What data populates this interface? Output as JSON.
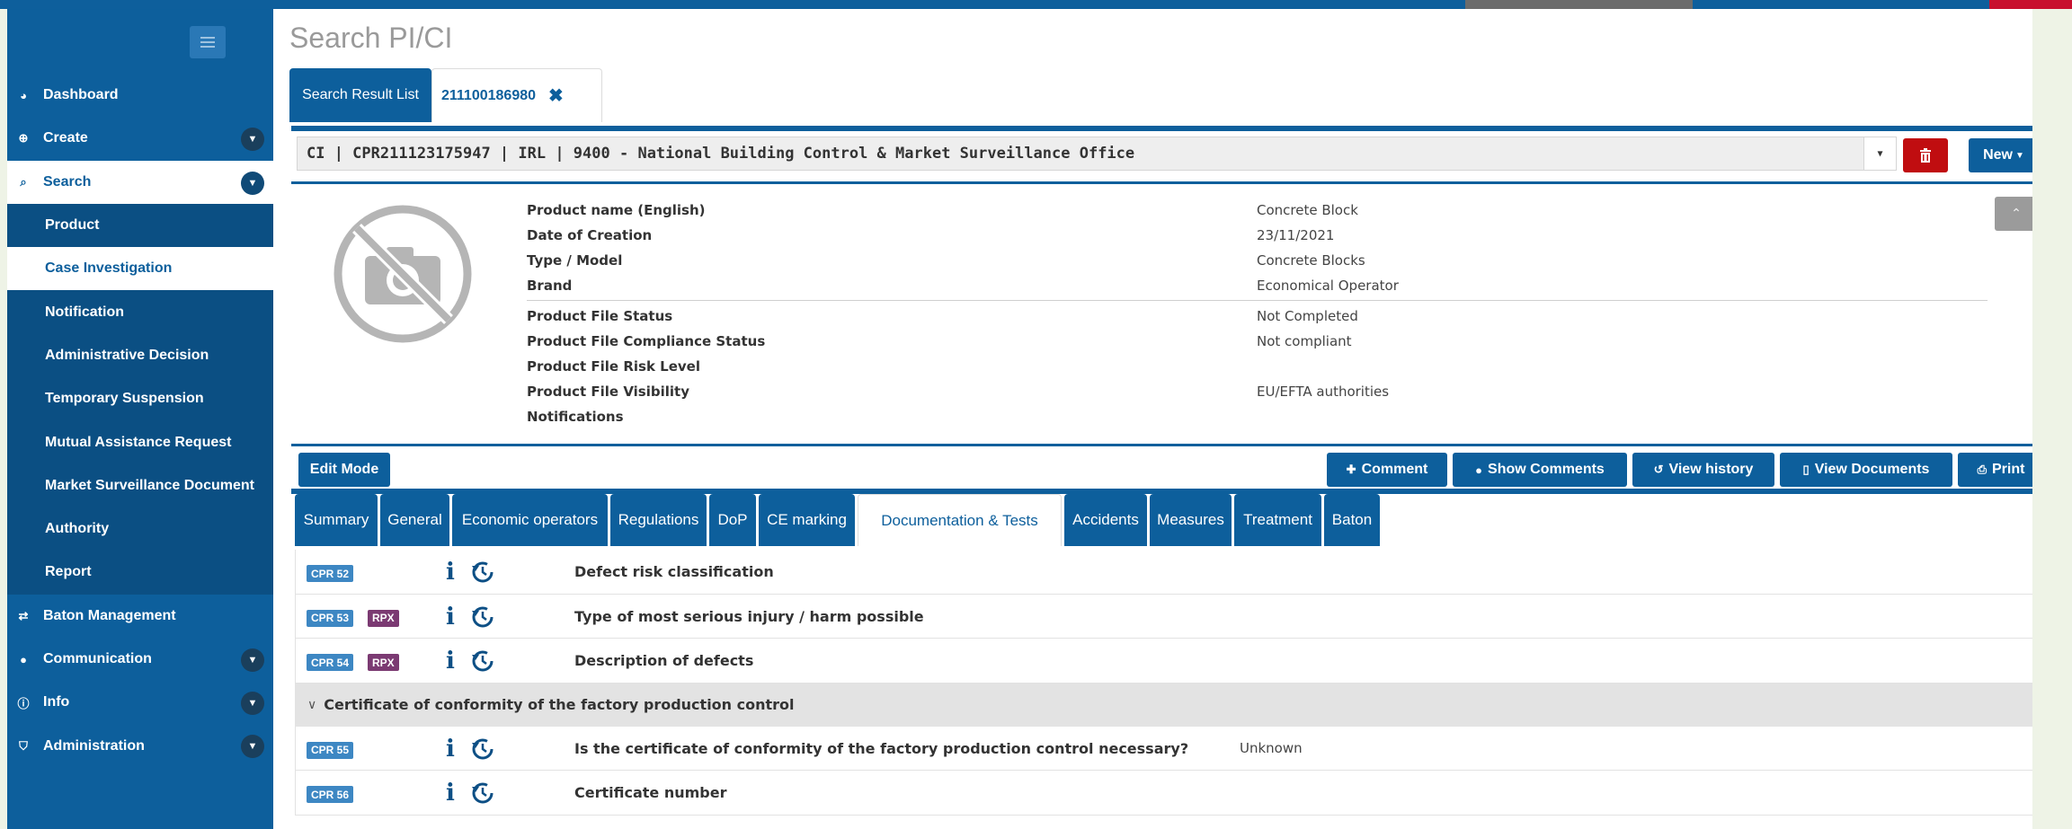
{
  "top_strip": {
    "segment_colors": [
      "#0e5f9c",
      "#6c6c6c",
      "#0e5f9c",
      "#0e5f9c",
      "#c8102e"
    ]
  },
  "sidebar": {
    "items": [
      {
        "label": "Dashboard",
        "icon": "dashboard-icon",
        "has_caret": false
      },
      {
        "label": "Create",
        "icon": "plus-circle-icon",
        "has_caret": true
      },
      {
        "label": "Search",
        "icon": "search-icon",
        "has_caret": true,
        "active": true
      },
      {
        "label": "Baton Management",
        "icon": "exchange-icon",
        "has_caret": false
      },
      {
        "label": "Communication",
        "icon": "chat-bubble-icon",
        "has_caret": true
      },
      {
        "label": "Info",
        "icon": "info-circle-icon",
        "has_caret": true
      },
      {
        "label": "Administration",
        "icon": "shield-icon",
        "has_caret": true
      }
    ],
    "search_sub": [
      "Product",
      "Case Investigation",
      "Notification",
      "Administrative Decision",
      "Temporary Suspension",
      "Mutual Assistance Request",
      "Market Surveillance Document",
      "Authority",
      "Report"
    ],
    "selected_sub": "Case Investigation"
  },
  "page": {
    "title": "Search PI/CI"
  },
  "top_tabs": {
    "list_label": "Search Result List",
    "record_label": "211100186980"
  },
  "record": {
    "selector_value": "CI | CPR211123175947 | IRL | 9400 - National Building Control & Market Surveillance Office",
    "new_label": "New"
  },
  "details": {
    "fields": [
      {
        "label": "Product name (English)",
        "value": "Concrete Block"
      },
      {
        "label": "Date of Creation",
        "value": "23/11/2021"
      },
      {
        "label": "Type / Model",
        "value": "Concrete Blocks"
      },
      {
        "label": "Brand",
        "value": "Economical Operator"
      },
      {
        "label": "Product File Status",
        "value": "Not Completed"
      },
      {
        "label": "Product File Compliance Status",
        "value": "Not compliant"
      },
      {
        "label": "Product File Risk Level",
        "value": ""
      },
      {
        "label": "Product File Visibility",
        "value": "EU/EFTA authorities"
      },
      {
        "label": "Notifications",
        "value": ""
      }
    ]
  },
  "actions": {
    "edit_mode": "Edit Mode",
    "comment": "Comment",
    "show_comments": "Show Comments",
    "view_history": "View history",
    "view_documents": "View Documents",
    "print": "Print"
  },
  "sub_tabs": [
    "Summary",
    "General",
    "Economic operators",
    "Regulations",
    "DoP",
    "CE marking",
    "Documentation & Tests",
    "Accidents",
    "Measures",
    "Treatment",
    "Baton"
  ],
  "active_sub_tab": "Documentation & Tests",
  "doc_rows": [
    {
      "code": "CPR 52",
      "rpx": "",
      "text": "Defect risk classification",
      "value": ""
    },
    {
      "code": "CPR 53",
      "rpx": "RPX",
      "text": "Type of most serious injury / harm possible",
      "value": ""
    },
    {
      "code": "CPR 54",
      "rpx": "RPX",
      "text": "Description of defects",
      "value": ""
    }
  ],
  "section": {
    "label": "Certificate of conformity of the factory production control"
  },
  "section_rows": [
    {
      "code": "CPR 55",
      "text": "Is the certificate of conformity of the factory production control necessary?",
      "value": "Unknown"
    },
    {
      "code": "CPR 56",
      "text": "Certificate number",
      "value": ""
    }
  ]
}
